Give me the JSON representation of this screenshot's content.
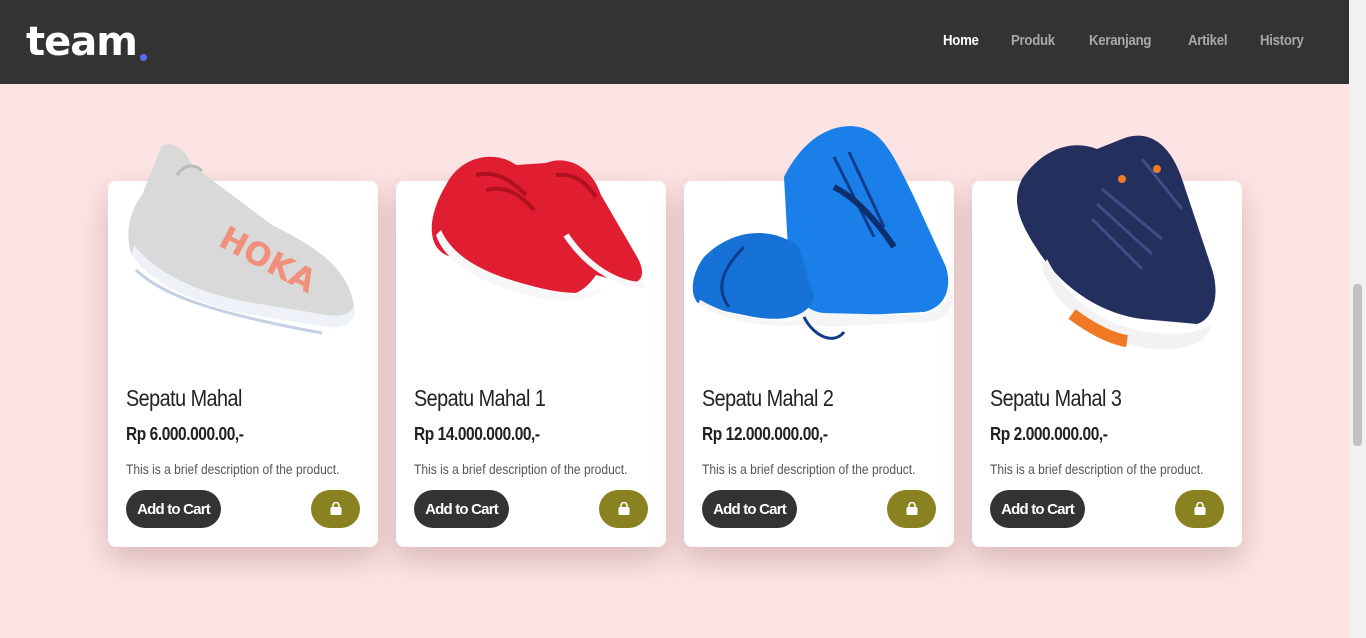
{
  "brand": {
    "name": "team",
    "dot_color": "#5b6bff"
  },
  "nav": {
    "items": [
      {
        "label": "Home",
        "active": true
      },
      {
        "label": "Produk",
        "active": false
      },
      {
        "label": "Keranjang",
        "active": false
      },
      {
        "label": "Artikel",
        "active": false
      },
      {
        "label": "History",
        "active": false
      }
    ]
  },
  "colors": {
    "navbar": "#333333",
    "page_background": "#fde4e4",
    "cart_button": "#333333",
    "bag_button": "#8a8120"
  },
  "products": [
    {
      "name": "Sepatu Mahal",
      "price": "Rp 6.000.000.00,-",
      "description": "This is a brief description of the product.",
      "add_label": "Add to Cart",
      "bag_icon": "shopping-bag-icon",
      "shoe_color": "#d9d9d9"
    },
    {
      "name": "Sepatu Mahal 1",
      "price": "Rp 14.000.000.00,-",
      "description": "This is a brief description of the product.",
      "add_label": "Add to Cart",
      "bag_icon": "shopping-bag-icon",
      "shoe_color": "#e11d32"
    },
    {
      "name": "Sepatu Mahal 2",
      "price": "Rp 12.000.000.00,-",
      "description": "This is a brief description of the product.",
      "add_label": "Add to Cart",
      "bag_icon": "shopping-bag-icon",
      "shoe_color": "#1a7fe8"
    },
    {
      "name": "Sepatu Mahal 3",
      "price": "Rp 2.000.000.00,-",
      "description": "This is a brief description of the product.",
      "add_label": "Add to Cart",
      "bag_icon": "shopping-bag-icon",
      "shoe_color": "#23305e"
    }
  ]
}
